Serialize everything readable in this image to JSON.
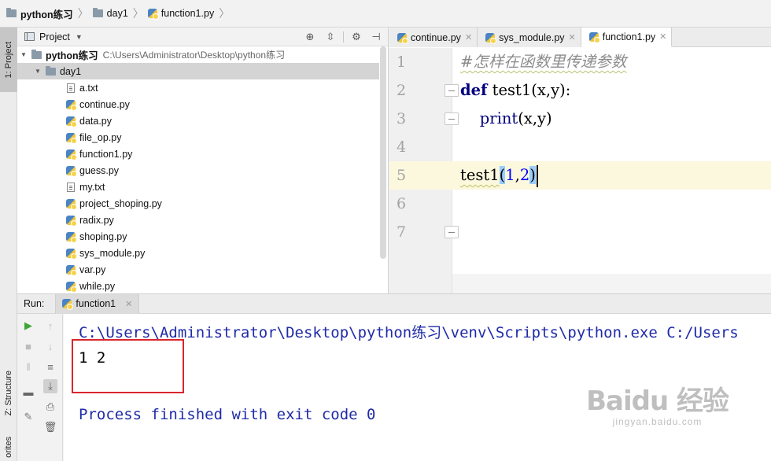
{
  "breadcrumb": {
    "project": "python练习",
    "folder": "day1",
    "file": "function1.py"
  },
  "left_strip": {
    "project_tab": "1: Project",
    "structure_tab": "Z: Structure",
    "favorites_tab": "orites"
  },
  "project_panel": {
    "title": "Project",
    "root": {
      "name": "python练习",
      "path": "C:\\Users\\Administrator\\Desktop\\python练习"
    },
    "folder": "day1",
    "files": [
      {
        "name": "a.txt",
        "icon": "text-file-icon"
      },
      {
        "name": "continue.py",
        "icon": "python-file-icon"
      },
      {
        "name": "data.py",
        "icon": "python-file-icon"
      },
      {
        "name": "file_op.py",
        "icon": "python-file-icon"
      },
      {
        "name": "function1.py",
        "icon": "python-file-icon"
      },
      {
        "name": "guess.py",
        "icon": "python-file-icon"
      },
      {
        "name": "my.txt",
        "icon": "text-file-icon"
      },
      {
        "name": "project_shoping.py",
        "icon": "python-file-icon"
      },
      {
        "name": "radix.py",
        "icon": "python-file-icon"
      },
      {
        "name": "shoping.py",
        "icon": "python-file-icon"
      },
      {
        "name": "sys_module.py",
        "icon": "python-file-icon"
      },
      {
        "name": "var.py",
        "icon": "python-file-icon"
      },
      {
        "name": "while.py",
        "icon": "python-file-icon"
      }
    ]
  },
  "editor": {
    "tabs": [
      {
        "label": "continue.py",
        "active": false
      },
      {
        "label": "sys_module.py",
        "active": false
      },
      {
        "label": "function1.py",
        "active": true
      }
    ],
    "line_numbers": [
      "1",
      "2",
      "3",
      "4",
      "5",
      "6",
      "7"
    ],
    "code": {
      "line1_comment": "#怎样在函数里传递参数",
      "line2_kw": "def",
      "line2_rest": " test1(x,y):",
      "line3_indent": "    ",
      "line3_builtin": "print",
      "line3_rest": "(x,y)",
      "line5_name": "test1",
      "line5_open": "(",
      "line5_a": "1",
      "line5_comma": ",",
      "line5_b": "2",
      "line5_close": ")"
    },
    "current_line": 5
  },
  "run_panel": {
    "label": "Run:",
    "tab": "function1",
    "console_lines": [
      "C:\\Users\\Administrator\\Desktop\\python练习\\venv\\Scripts\\python.exe C:/Users",
      "1 2",
      "Process finished with exit code 0"
    ]
  },
  "watermark": {
    "logo": "Baidu 经验",
    "url": "jingyan.baidu.com"
  },
  "colors": {
    "keyword": "#000080",
    "number": "#0000ff",
    "comment": "#8c8c8c",
    "console_sys": "#1f2ba8",
    "current_line": "#fcf8dd",
    "highlight_box": "#d9262c"
  }
}
